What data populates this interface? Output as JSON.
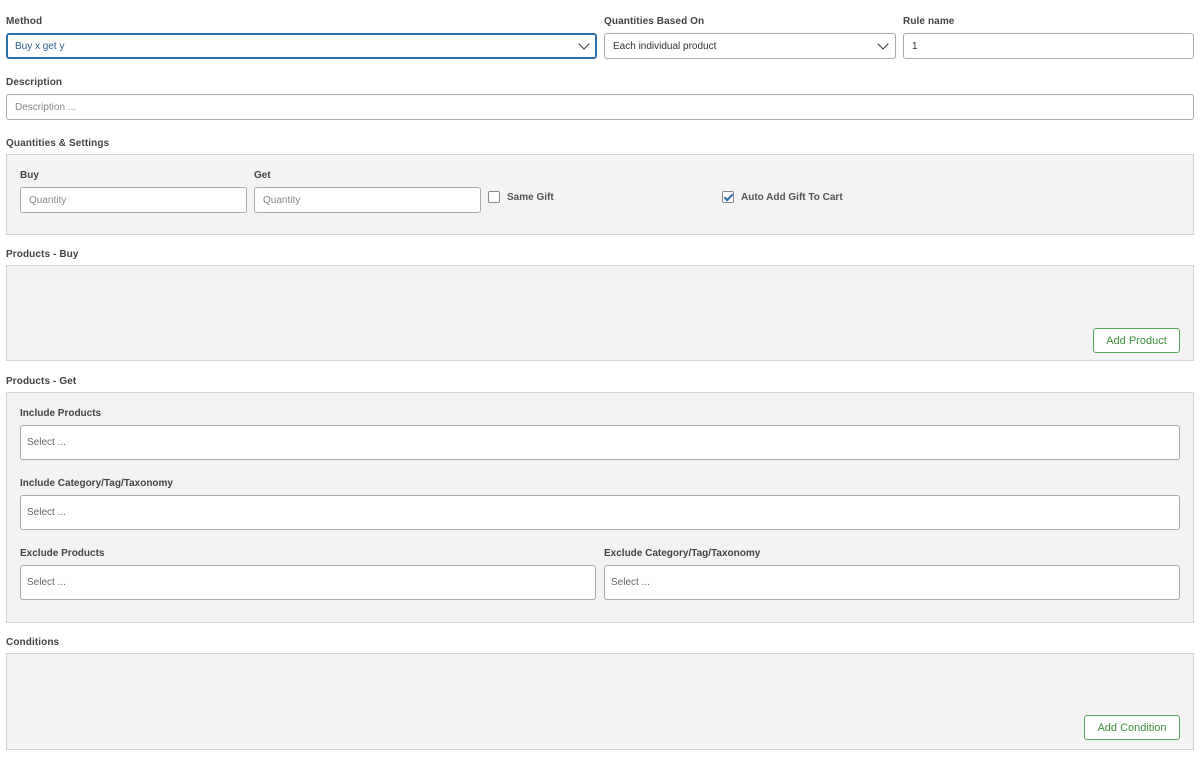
{
  "method": {
    "label": "Method",
    "value": "Buy x get y"
  },
  "quantities_based_on": {
    "label": "Quantities Based On",
    "value": "Each individual product"
  },
  "rule_name": {
    "label": "Rule name",
    "value": "1"
  },
  "description": {
    "label": "Description",
    "placeholder": "Description ..."
  },
  "quantities_settings": {
    "title": "Quantities & Settings",
    "buy_label": "Buy",
    "buy_placeholder": "Quantity",
    "get_label": "Get",
    "get_placeholder": "Quantity",
    "same_gift_label": "Same Gift",
    "same_gift_checked": false,
    "auto_add_label": "Auto Add Gift To Cart",
    "auto_add_checked": true
  },
  "products_buy": {
    "title": "Products - Buy",
    "add_button": "Add Product"
  },
  "products_get": {
    "title": "Products - Get",
    "include_products_label": "Include Products",
    "include_products_placeholder": "Select ...",
    "include_category_label": "Include Category/Tag/Taxonomy",
    "include_category_placeholder": "Select ...",
    "exclude_products_label": "Exclude Products",
    "exclude_products_placeholder": "Select ...",
    "exclude_category_label": "Exclude Category/Tag/Taxonomy",
    "exclude_category_placeholder": "Select ..."
  },
  "conditions": {
    "title": "Conditions",
    "add_button": "Add Condition"
  },
  "colors": {
    "accent": "#2d6ea8",
    "button_green": "#3f8f3f",
    "panel_bg": "#f3f3f3"
  },
  "icons": {
    "dropdown": "chevron-down-icon",
    "checkbox_checked": "checkmark-icon"
  }
}
